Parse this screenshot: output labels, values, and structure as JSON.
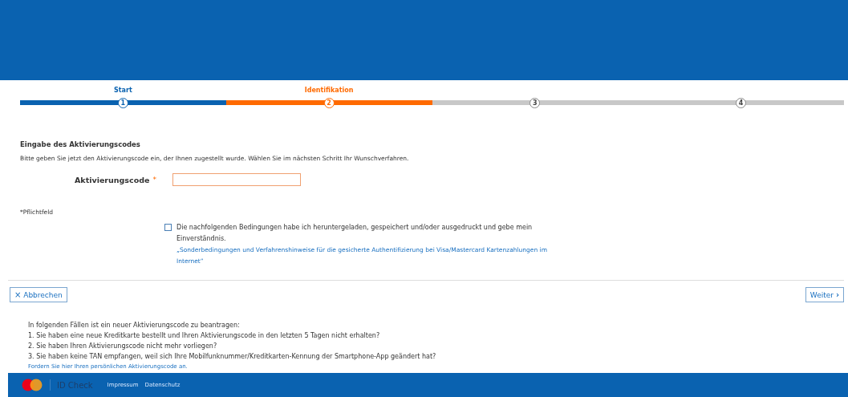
{
  "steps": [
    {
      "label": "Start",
      "number": "1",
      "kind": "done"
    },
    {
      "label": "Identifikation",
      "number": "2",
      "kind": "active"
    },
    {
      "number": "3",
      "kind": "todo"
    },
    {
      "number": "4",
      "kind": "todo"
    }
  ],
  "form": {
    "heading": "Eingabe des Aktivierungscodes",
    "intro": "Bitte geben Sie jetzt den Aktivierungscode ein, der Ihnen zugestellt wurde. Wählen Sie im nächsten Schritt Ihr Wunschverfahren.",
    "field_label": "Aktivierungscode",
    "required_mark": "*",
    "required_note": "*Pflichtfeld",
    "consent": {
      "checked": false,
      "text": "Die nachfolgenden Bedingungen habe ich heruntergeladen, gespeichert und/oder ausgedruckt und gebe mein Einverständnis.",
      "link": "„Sonderbedingungen und Verfahrenshinweise für die gesicherte Authentifizierung bei Visa/Mastercard Kartenzahlungen im Internet“"
    }
  },
  "buttons": {
    "cancel": {
      "icon": "×",
      "label": "Abbrechen"
    },
    "next": {
      "label": "Weiter",
      "icon": "›"
    }
  },
  "info": {
    "intro": "In folgenden Fällen ist ein neuer Aktivierungscode zu beantragen:",
    "items": [
      "1. Sie haben eine neue Kreditkarte bestellt und Ihren Aktivierungscode in den letzten 5 Tagen nicht erhalten?",
      "2. Sie haben Ihren Aktivierungscode nicht mehr vorliegen?",
      "3. Sie haben keine TAN empfangen, weil sich Ihre Mobilfunknummer/Kreditkarten-Kennung der Smartphone-App geändert hat?"
    ],
    "link": "Fordern Sie hier Ihren persönlichen Aktivierungscode an."
  },
  "footer": {
    "brand": "ID Check",
    "links": [
      "Impressum",
      "Datenschutz"
    ]
  }
}
